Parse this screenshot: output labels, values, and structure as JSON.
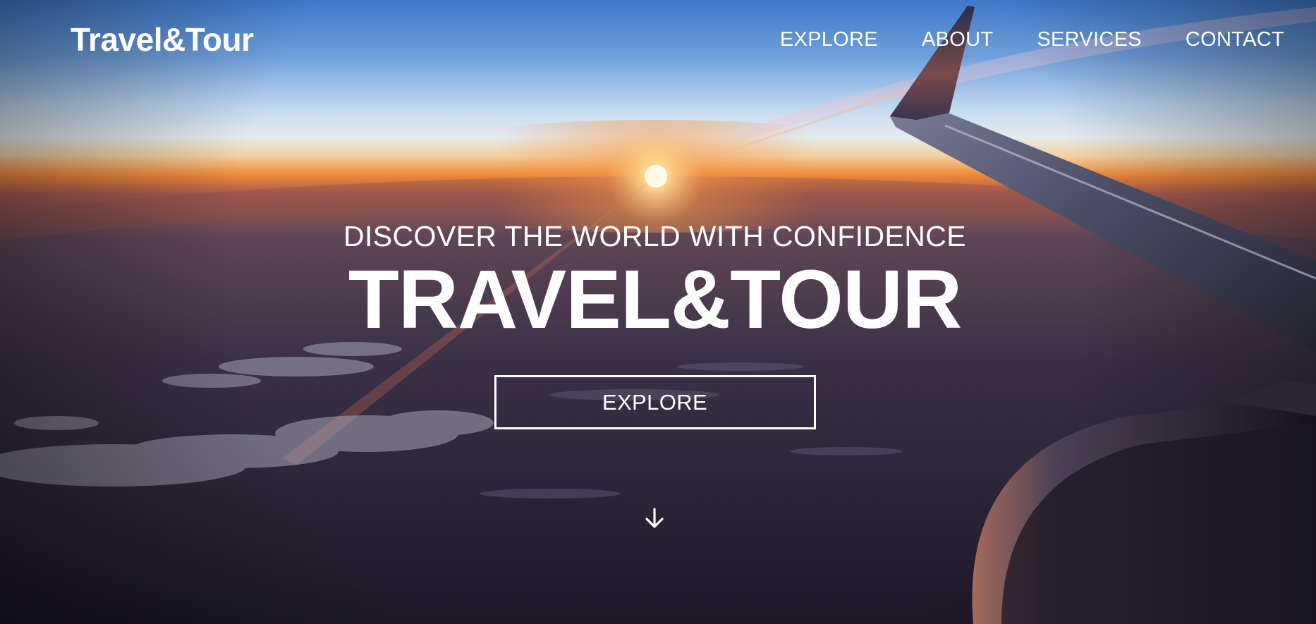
{
  "brand": {
    "name": "Travel&Tour"
  },
  "nav": {
    "items": [
      {
        "label": "EXPLORE"
      },
      {
        "label": "ABOUT"
      },
      {
        "label": "SERVICES"
      },
      {
        "label": "CONTACT"
      }
    ]
  },
  "hero": {
    "subtitle": "DISCOVER THE WORLD WITH CONFIDENCE",
    "title": "TRAVEL&TOUR",
    "cta_label": "EXPLORE",
    "scroll_icon": "arrow-down-icon",
    "background_image": "sunset-over-clouds-airplane-wing-photo"
  },
  "colors": {
    "text": "#ffffff",
    "sky_top": "#3f78c9",
    "horizon_orange": "#f08a3a",
    "ground_dark": "#1e1a2c"
  }
}
